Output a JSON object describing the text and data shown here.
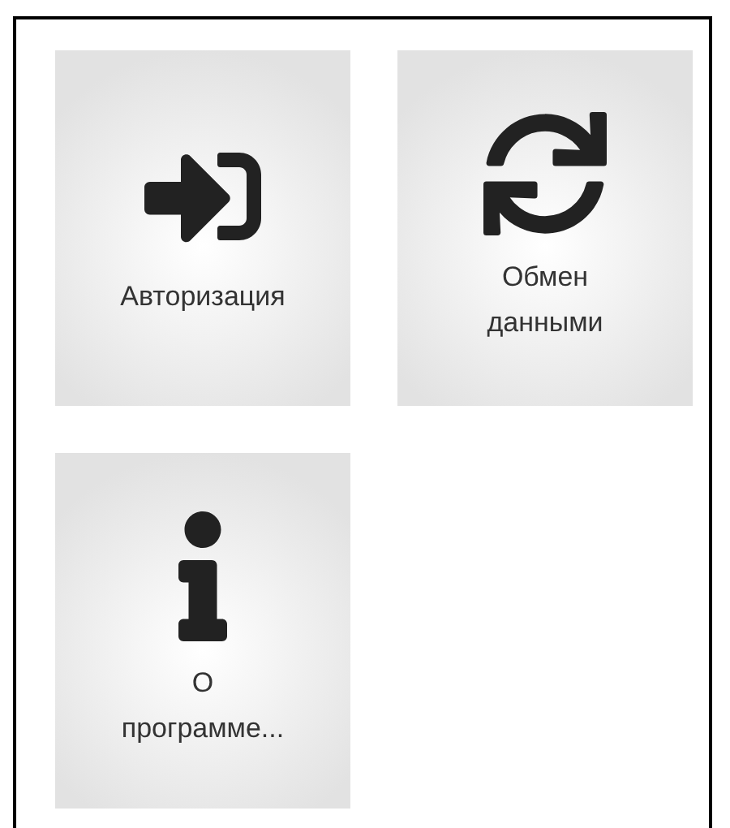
{
  "tiles": [
    {
      "kind": "sign-in",
      "label": "Авторизация"
    },
    {
      "kind": "sync",
      "label": "Обмен данными"
    },
    {
      "kind": "info",
      "label": "О программе..."
    }
  ]
}
